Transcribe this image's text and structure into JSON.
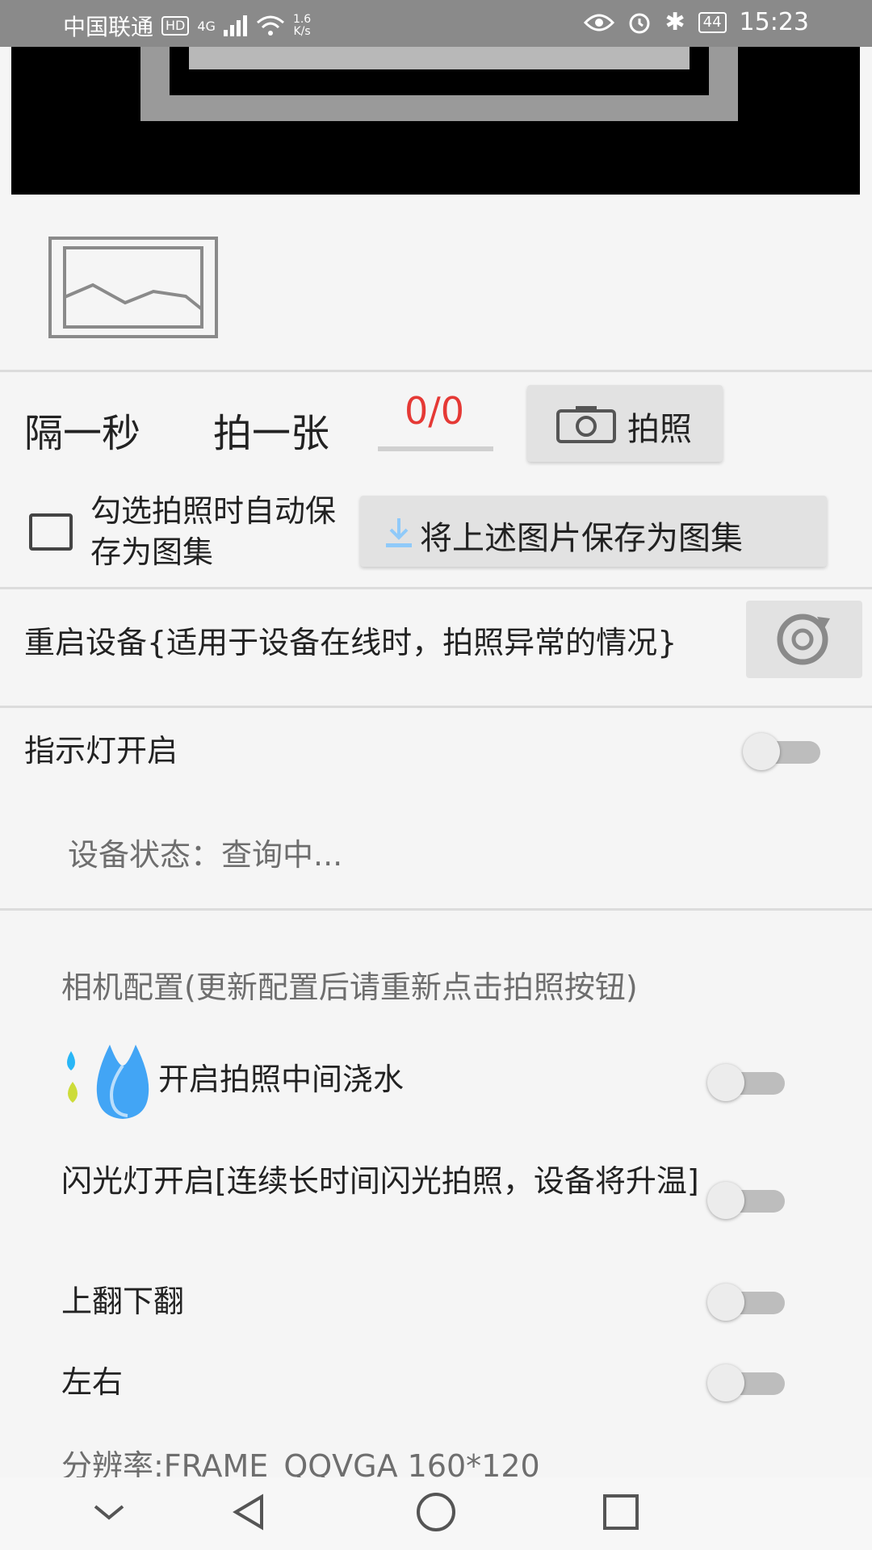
{
  "status_bar": {
    "carrier": "中国联通",
    "hd": "HD",
    "network": "4G",
    "speed_value": "1.6",
    "speed_unit": "K/s",
    "battery": "44",
    "time": "15:23"
  },
  "capture": {
    "interval_label": "隔一秒",
    "shot_label": "拍一张",
    "counter": "0/0",
    "snap_button": "拍照",
    "auto_save_label": "勾选拍照时自动保存为图集",
    "auto_save_checked": false,
    "save_album_button": "将上述图片保存为图集"
  },
  "device": {
    "restart_label": "重启设备{适用于设备在线时，拍照异常的情况}",
    "indicator_label": "指示灯开启",
    "indicator_on": false,
    "status_text": "设备状态：查询中..."
  },
  "camera_config": {
    "title": "相机配置(更新配置后请重新点击拍照按钮)",
    "watering_label": "开启拍照中间浇水",
    "watering_on": false,
    "flash_label": "闪光灯开启[连续长时间闪光拍照，设备将升温]",
    "flash_on": false,
    "flip_vertical_label": "上翻下翻",
    "flip_vertical_on": false,
    "flip_horizontal_label": "左右",
    "flip_horizontal_on": false,
    "resolution_text": "分辨率:FRAME_QQVGA  160*120"
  },
  "icons": {
    "thumbnail": "image-placeholder-icon",
    "camera": "camera-icon",
    "download": "download-icon",
    "refresh": "refresh-icon",
    "water": "water-drop-icon"
  },
  "colors": {
    "accent_counter": "#e53935",
    "status_bar_bg": "#8a8a8a"
  }
}
